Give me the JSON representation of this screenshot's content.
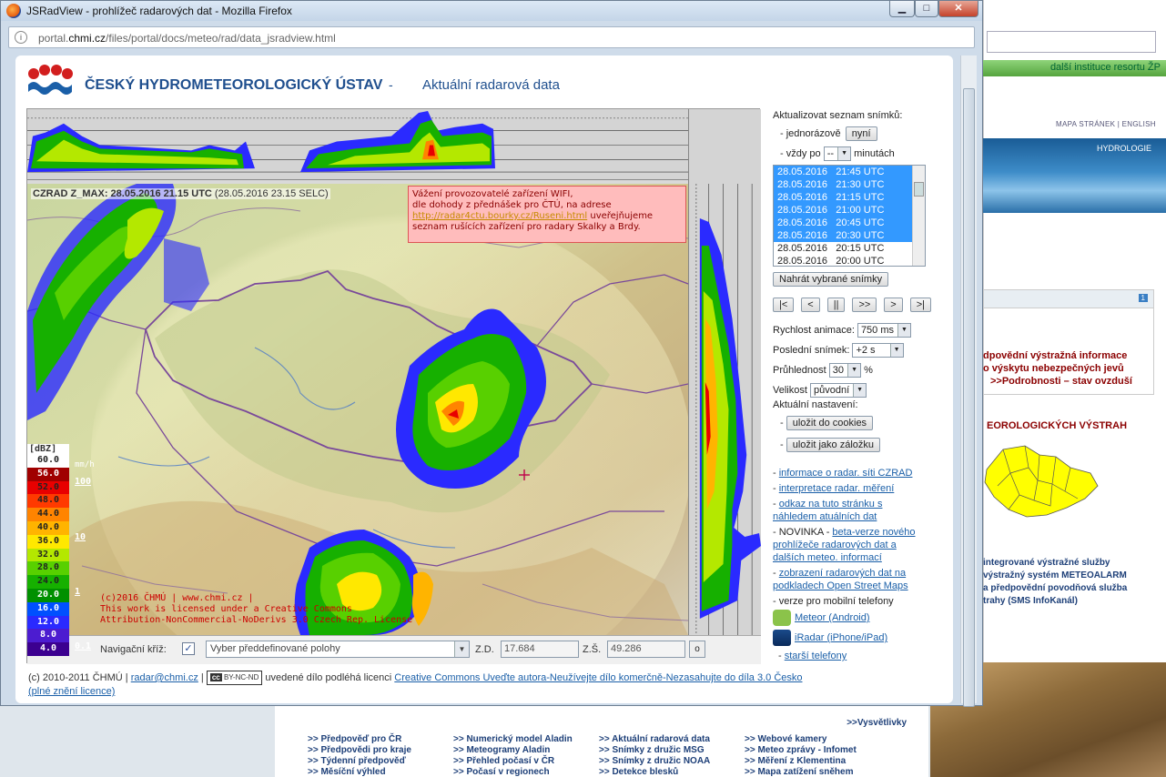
{
  "browser": {
    "title": "JSRadView - prohlížeč radarových dat - Mozilla Firefox",
    "url_prefix": "portal.",
    "url_domain": "chmi.cz",
    "url_path": "/files/portal/docs/meteo/rad/data_jsradview.html",
    "controls": {
      "minimize": "▁",
      "maximize": "□",
      "close": "✕"
    }
  },
  "header": {
    "org_name": "ČESKÝ HYDROMETEOROLOGICKÝ ÚSTAV",
    "dash": "-",
    "subtitle": "Aktuální radarová data"
  },
  "radar": {
    "product": "CZRAD Z_MAX: 28.05.2016 21.15 UTC",
    "local_time": "(28.05.2016 23.15 SELC)",
    "notice_line1": "Vážení provozovatelé zařízení WIFI,",
    "notice_line2": "dle dohody z přednášek pro ČTÚ, na adrese",
    "notice_link": "http://radar4ctu.bourky.cz/Ruseni.html",
    "notice_line3": " uveřejňujeme",
    "notice_line4": "seznam rušících zařízení pro radary Skalky a Brdy.",
    "copyright1": "(c)2016 ČHMÚ | www.chmi.cz |",
    "copyright2": "This work is licensed under a Creative Commons",
    "copyright3": "Attribution-NonCommercial-NoDerivs 3.0 Czech Rep. License",
    "legend_title": "[dBZ]",
    "mmh": "mm/h",
    "legend": [
      {
        "label": "60.0",
        "color": "#ffffff"
      },
      {
        "label": "56.0",
        "color": "#a00000"
      },
      {
        "label": "52.0",
        "color": "#e80000"
      },
      {
        "label": "48.0",
        "color": "#ff3a00"
      },
      {
        "label": "44.0",
        "color": "#ff8400"
      },
      {
        "label": "40.0",
        "color": "#ffb400"
      },
      {
        "label": "36.0",
        "color": "#ffe800"
      },
      {
        "label": "32.0",
        "color": "#b4e800"
      },
      {
        "label": "28.0",
        "color": "#58d000"
      },
      {
        "label": "24.0",
        "color": "#16b000"
      },
      {
        "label": "20.0",
        "color": "#009000"
      },
      {
        "label": "16.0",
        "color": "#0050ff"
      },
      {
        "label": "12.0",
        "color": "#2a2aff"
      },
      {
        "label": "8.0",
        "color": "#4c1cd0"
      },
      {
        "label": "4.0",
        "color": "#3c0090"
      }
    ],
    "mmh_values": [
      "100",
      "10",
      "1",
      "0.1"
    ]
  },
  "navbar": {
    "label": "Navigační kříž:",
    "checkbox": "✓",
    "select_placeholder": "Vyber předdefinované polohy",
    "lon_label": "Z.D.",
    "lon_value": "17.684",
    "lat_label": "Z.Š.",
    "lat_value": "49.286",
    "go_label": "o"
  },
  "panel": {
    "refresh_title": "Aktualizovat seznam snímků:",
    "once_label": "jednorázově",
    "now_button": "nyní",
    "every_label": "vždy po",
    "every_value": "--",
    "minutes_label": "minutách",
    "snapshots": [
      {
        "text": "28.05.2016   21:45 UTC",
        "selected": true
      },
      {
        "text": "28.05.2016   21:30 UTC",
        "selected": true
      },
      {
        "text": "28.05.2016   21:15 UTC",
        "selected": true
      },
      {
        "text": "28.05.2016   21:00 UTC",
        "selected": true
      },
      {
        "text": "28.05.2016   20:45 UTC",
        "selected": true
      },
      {
        "text": "28.05.2016   20:30 UTC",
        "selected": true
      },
      {
        "text": "28.05.2016   20:15 UTC",
        "selected": false
      },
      {
        "text": "28.05.2016   20:00 UTC",
        "selected": false
      }
    ],
    "load_button": "Nahrát vybrané snímky",
    "nav_buttons": [
      "|<",
      "<",
      "||",
      ">>",
      ">",
      ">|"
    ],
    "speed_label": "Rychlost animace:",
    "speed_value": "750 ms",
    "last_label": "Poslední snímek:",
    "last_value": "+2 s",
    "opacity_label": "Průhlednost",
    "opacity_value": "30",
    "opacity_unit": "%",
    "size_label": "Velikost",
    "size_value": "původní",
    "current_label": "Aktuální nastavení:",
    "cookies_button": "uložit do cookies",
    "bookmark_button": "uložit jako záložku",
    "link_info": "informace o radar. síti CZRAD",
    "link_interp": "interpretace radar. měření",
    "link_page_1": "odkaz na tuto stránku s",
    "link_page_2": "náhledem atuálních dat",
    "novinka": "NOVINKA -",
    "link_beta_1": "beta-verze nového",
    "link_beta_2": "prohlížeče radarových dat a",
    "link_beta_3": "dalších meteo. informací",
    "link_osm_1": "zobrazení radarových dat na",
    "link_osm_2": "podkladech Open Street Maps",
    "mobile_label": "verze pro mobilní telefony",
    "meteor_link": "Meteor (Android)",
    "iradar_link": "iRadar (iPhone/iPad)",
    "old_phones": "starší telefony"
  },
  "footer": {
    "copyright": "(c) 2010-2011 ČHMÚ |",
    "email": "radar@chmi.cz",
    "sep": "|",
    "cc_badge": "BY-NC-ND",
    "license_text": "uvedené dílo podléhá licenci",
    "license_link": "Creative Commons Uveďte autora-Neužívejte dílo komerčně-Nezasahujte do díla 3.0 Česko",
    "full_link": "(plné znění licence)"
  },
  "background_site": {
    "institutions": "další instituce resortu ŽP",
    "top_links": "MAPA STRÁNEK | ENGLISH",
    "hydrologie": "HYDROLOGIE",
    "badge": "1",
    "warn1": "dpovědní výstražná informace",
    "warn2": "o výskytu nebezpečných jevů",
    "warn3": ">>Podrobnosti – stav ovzduší",
    "meteo_title": "EOROLOGICKÝCH VÝSTRAH",
    "service1": "integrované výstražné služby",
    "service2": "výstražný systém METEOALARM",
    "service3": "a předpovědní povodňová služba",
    "service4": "trahy (SMS InfoKanál)",
    "vysvetlivky": ">>Vysvětlivky",
    "bottom_cols": [
      [
        ">> Předpověď pro ČR",
        ">> Předpovědi pro kraje",
        ">> Týdenní předpověď",
        ">> Měsíční výhled"
      ],
      [
        ">> Numerický model Aladin",
        ">> Meteogramy Aladin",
        ">> Přehled počasí v ČR",
        ">> Počasí v regionech"
      ],
      [
        ">> Aktuální radarová data",
        ">> Snímky z družic MSG",
        ">> Snímky z družic NOAA",
        ">> Detekce blesků"
      ],
      [
        ">> Webové kamery",
        ">> Meteo zprávy - Infomet",
        ">> Měření z Klementina",
        ">> Mapa zatížení sněhem"
      ]
    ]
  }
}
